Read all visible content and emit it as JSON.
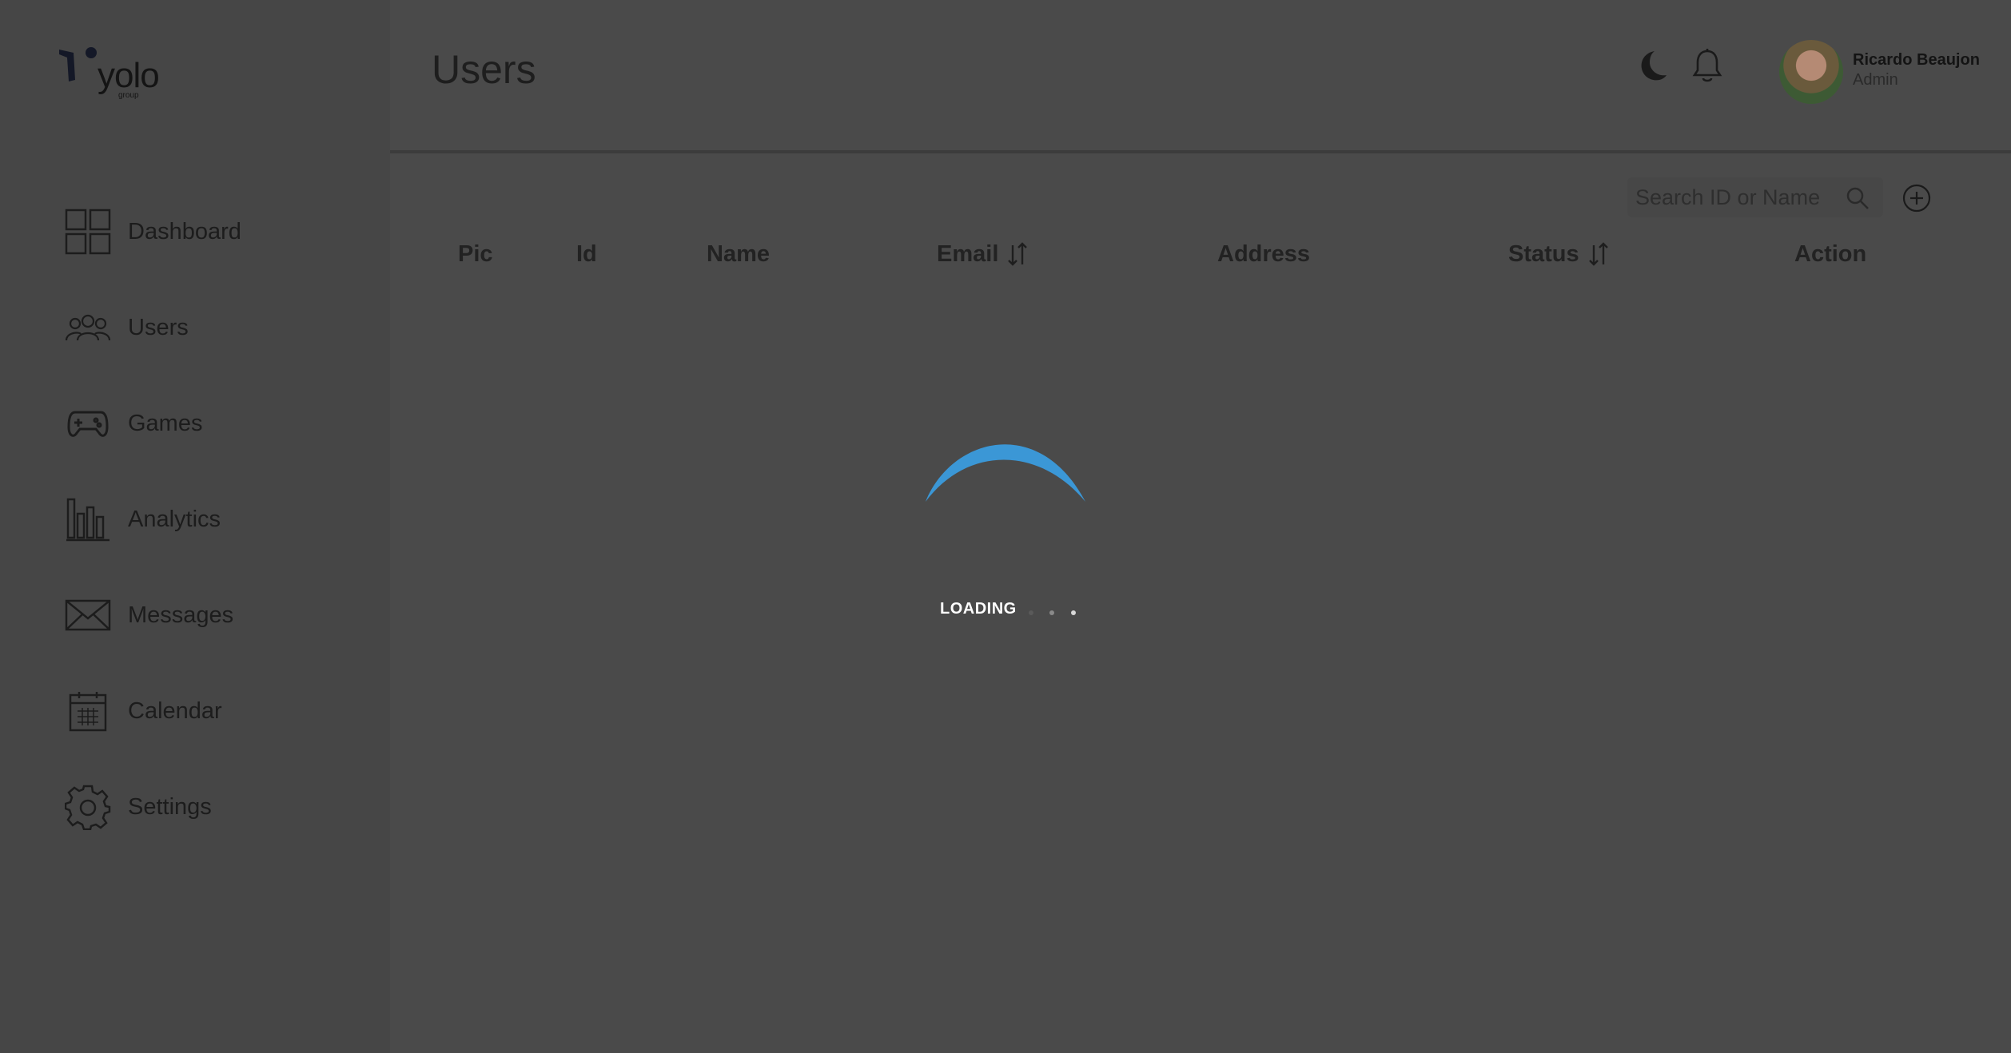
{
  "app": {
    "logo_text": "yolo",
    "logo_subtext": "group"
  },
  "sidebar": {
    "items": [
      {
        "label": "Dashboard",
        "icon": "grid-icon"
      },
      {
        "label": "Users",
        "icon": "users-icon"
      },
      {
        "label": "Games",
        "icon": "gamepad-icon"
      },
      {
        "label": "Analytics",
        "icon": "bar-chart-icon"
      },
      {
        "label": "Messages",
        "icon": "envelope-icon"
      },
      {
        "label": "Calendar",
        "icon": "calendar-icon"
      },
      {
        "label": "Settings",
        "icon": "gear-icon"
      }
    ]
  },
  "header": {
    "title": "Users",
    "user": {
      "name": "Ricardo Beaujon",
      "role": "Admin"
    }
  },
  "toolbar": {
    "search_placeholder": "Search ID or Name"
  },
  "table": {
    "columns": [
      "Pic",
      "Id",
      "Name",
      "Email",
      "Address",
      "Status",
      "Action"
    ]
  },
  "loader": {
    "text": "LOADING",
    "accent_color": "#3b97d6"
  }
}
